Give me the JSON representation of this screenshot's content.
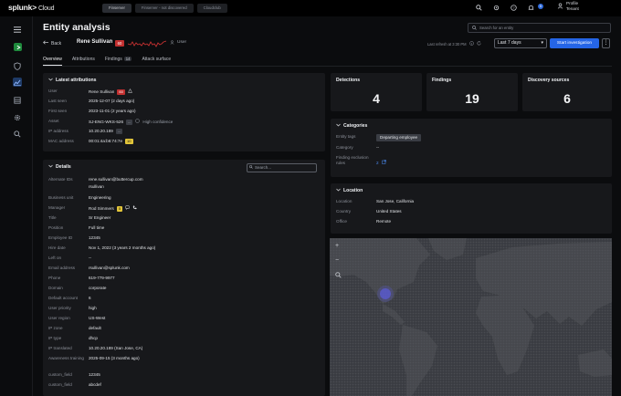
{
  "brand": {
    "name": "splunk>",
    "product": "Cloud"
  },
  "topnav": [
    "Finserver",
    "Finserver - not discovered",
    "Cloudclub"
  ],
  "top_icons": [
    "search-icon",
    "settings-icon",
    "help-icon",
    "bell-icon"
  ],
  "notifications_count": "5",
  "profile": {
    "line1": "Profile",
    "line2": "Tenant"
  },
  "rail": [
    "menu-icon",
    "app-logo",
    "shield-icon",
    "activity-icon",
    "list-icon",
    "gear-icon",
    "search-icon"
  ],
  "page": {
    "title": "Entity analysis",
    "search_placeholder": "Search for an entity",
    "back_label": "Back",
    "entity_name": "Rene Sullivan",
    "risk_score": "60",
    "entity_type": "User",
    "last_refresh": "Last refresh at 3:30 PM",
    "time_range": "Last 7 days",
    "start_button": "Start investigation"
  },
  "tabs": [
    {
      "label": "Overview",
      "count": ""
    },
    {
      "label": "Attributions",
      "count": ""
    },
    {
      "label": "Findings",
      "count": "14"
    },
    {
      "label": "Attack surface",
      "count": ""
    }
  ],
  "latest": {
    "title": "Latest attributions",
    "rows": [
      {
        "k": "User",
        "v": "Rene Sullivan"
      },
      {
        "k": "Last seen",
        "v": "2025-12-07 (2 days ago)"
      },
      {
        "k": "First seen",
        "v": "2023-11-01 (2 years ago)"
      },
      {
        "k": "Asset",
        "v": "SJ-ENG-WKS-526"
      },
      {
        "k": "IP address",
        "v": "10.20.20.189"
      },
      {
        "k": "MAC address",
        "v": "00:01:4a:b6:74:7e"
      }
    ],
    "user_badge": "60",
    "asset_badge": "...",
    "asset_note": "High confidence",
    "ip_badge": "...",
    "mac_badge": "10"
  },
  "stats": [
    {
      "label": "Detections",
      "value": "4"
    },
    {
      "label": "Findings",
      "value": "19"
    },
    {
      "label": "Discovery sources",
      "value": "6"
    }
  ],
  "categories": {
    "title": "Categories",
    "rows": [
      {
        "k": "Entity tags",
        "v": "Departing employee"
      },
      {
        "k": "Category",
        "v": "--"
      },
      {
        "k": "Finding exclusion rules",
        "v": "2"
      }
    ]
  },
  "location": {
    "title": "Location",
    "rows": [
      {
        "k": "Location",
        "v": "San Jose, California"
      },
      {
        "k": "Country",
        "v": "United States"
      },
      {
        "k": "Office",
        "v": "Remote"
      }
    ]
  },
  "details": {
    "title": "Details",
    "search_placeholder": "Search...",
    "rows": [
      {
        "k": "Alternate IDs",
        "v": "rene.sullivan@buttercup.com"
      },
      {
        "k": "",
        "v": "rsullivan"
      },
      {
        "k": "Business unit",
        "v": "Engineering"
      },
      {
        "k": "Manager",
        "v": "Rod Simmers"
      },
      {
        "k": "Title",
        "v": "Sr Engineer"
      },
      {
        "k": "Position",
        "v": "Full time"
      },
      {
        "k": "Employee ID",
        "v": "12345"
      },
      {
        "k": "Hire date",
        "v": "Nov 1, 2022 (3 years 2 months ago)"
      },
      {
        "k": "Left on",
        "v": "--"
      },
      {
        "k": "Email address",
        "v": "rsullivan@splunk.com"
      },
      {
        "k": "Phone",
        "v": "619-779-9977"
      },
      {
        "k": "Domain",
        "v": "corporate"
      },
      {
        "k": "Default account",
        "v": "6"
      },
      {
        "k": "User priority",
        "v": "high"
      },
      {
        "k": "User region",
        "v": "US-West"
      },
      {
        "k": "IP zone",
        "v": "default"
      },
      {
        "k": "IP type",
        "v": "dhcp"
      },
      {
        "k": "IP translated",
        "v": "10.20.20.189 (San Jose, CA)"
      },
      {
        "k": "Awareness training",
        "v": "2025-09-15 (3 months ago)"
      },
      {
        "k": "custom_field",
        "v": "12345"
      },
      {
        "k": "custom_field",
        "v": "abcdef"
      }
    ],
    "manager_badge": "5"
  },
  "map_controls": [
    "zoom-in-icon",
    "zoom-out-icon",
    "zoom-reset-icon"
  ]
}
